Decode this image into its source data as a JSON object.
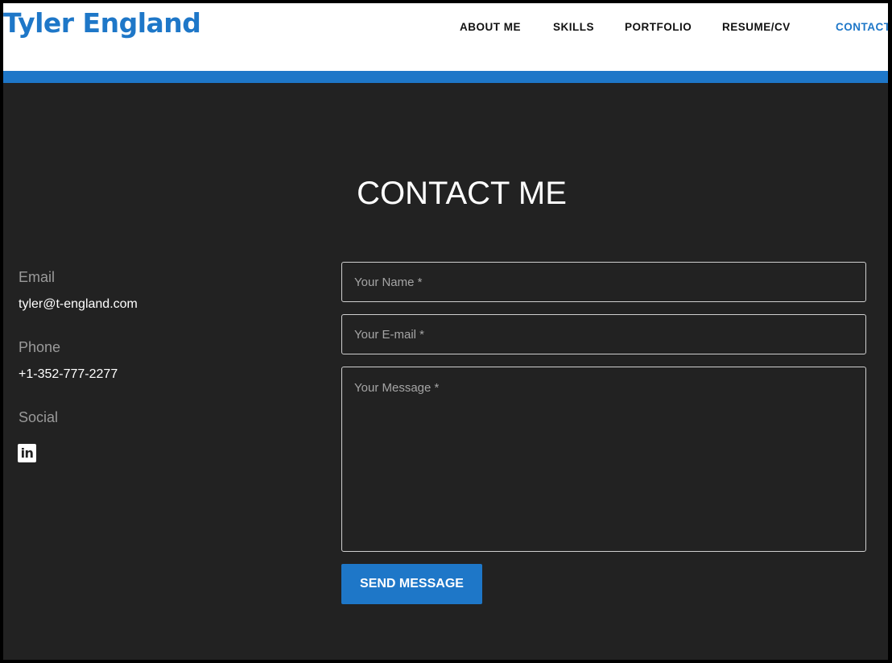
{
  "header": {
    "logo": "Tyler England",
    "nav": [
      {
        "label": "ABOUT ME"
      },
      {
        "label": "SKILLS"
      },
      {
        "label": "PORTFOLIO"
      },
      {
        "label": "RESUME/CV"
      },
      {
        "label": "CONTACT"
      }
    ],
    "active_nav": "CONTACT",
    "accent_color": "#1e77c8"
  },
  "main": {
    "title": "CONTACT ME"
  },
  "info": {
    "email_label": "Email",
    "email_value": "tyler@t-england.com",
    "phone_label": "Phone",
    "phone_value": "+1-352-777-2277",
    "social_label": "Social",
    "social_icon": "linkedin-icon",
    "social_icon_glyph": "in"
  },
  "form": {
    "name_placeholder": "Your Name *",
    "name_value": "",
    "email_placeholder": "Your E-mail *",
    "email_value": "",
    "message_placeholder": "Your Message *",
    "message_value": "",
    "submit_label": "SEND MESSAGE"
  },
  "colors": {
    "background": "#222222",
    "header_bg": "#ffffff",
    "accent": "#1e77c8"
  }
}
